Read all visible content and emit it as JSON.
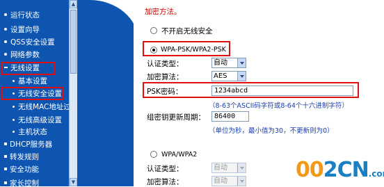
{
  "sidebar": {
    "items": [
      {
        "label": "运行状态"
      },
      {
        "label": "设置向导"
      },
      {
        "label": "QSS安全设置"
      },
      {
        "label": "网络参数"
      },
      {
        "label": "无线设置"
      },
      {
        "label": "基本设置"
      },
      {
        "label": "无线安全设置"
      },
      {
        "label": "无线MAC地址过滤"
      },
      {
        "label": "无线高级设置"
      },
      {
        "label": "主机状态"
      },
      {
        "label": "DHCP服务器"
      },
      {
        "label": "转发规则"
      },
      {
        "label": "安全功能"
      },
      {
        "label": "家长控制"
      }
    ]
  },
  "main": {
    "encryption_heading": "加密方法。",
    "options": {
      "disable": "不开启无线安全",
      "wpa_psk": "WPA-PSK/WPA2-PSK",
      "wpa": "WPA/WPA2"
    },
    "psk": {
      "auth_label": "认证类型：",
      "auth_value": "自动",
      "algo_label": "加密算法：",
      "algo_value": "AES",
      "key_label": "PSK密码：",
      "key_value": "1234abcd",
      "key_hint": "（8-63个ASCII码字符或8-64个十六进制字符）",
      "renew_label": "组密钥更新周期：",
      "renew_value": "86400",
      "renew_hint": "（单位为秒，最小值为30，不更新则为0）"
    },
    "wpa": {
      "auth_label": "认证类型：",
      "auth_value": "自动",
      "algo_label": "加密算法：",
      "algo_value": "自动"
    }
  },
  "watermark": {
    "digits_a": "0",
    "digits_b": "0",
    "digits_c": "2",
    "letters": "CN",
    "suffix": ".com"
  },
  "colors": {
    "sidebar": "#0d55b0",
    "highlight": "#e01010",
    "heading": "#cc0000",
    "hint": "#1a3fb0",
    "logo_blue": "#1b7fc4",
    "logo_orange": "#f29a18"
  }
}
